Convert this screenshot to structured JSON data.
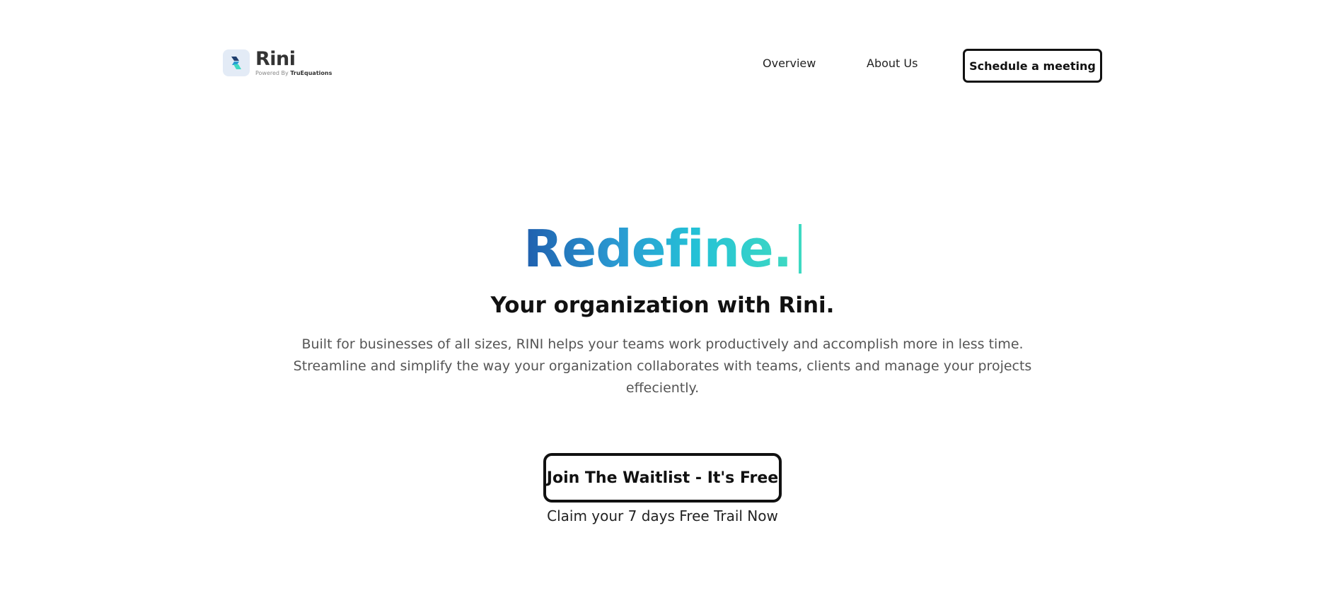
{
  "header": {
    "logo": {
      "name": "Rini",
      "tag_prefix": "Powered By",
      "tag_brand": "TruEquations",
      "icon": "rini-logo-icon"
    },
    "nav": [
      {
        "label": "Overview"
      },
      {
        "label": "About Us"
      }
    ],
    "schedule_label": "Schedule a meeting"
  },
  "hero": {
    "title": "Redefine.",
    "subtitle": "Your organization with Rini.",
    "description": "Built for businesses of all sizes, RINI helps your teams work productively and accomplish more in less time. Streamline and simplify the way your organization collaborates with teams, clients and manage your projects effeciently.",
    "cta_label": "Join The Waitlist - It's Free",
    "cta_sub": "Claim your 7 days Free Trail Now"
  },
  "colors": {
    "gradient_start": "#1f5fae",
    "gradient_end": "#3ed9c2",
    "text_dark": "#111111",
    "text_muted": "#555555",
    "logo_bg": "#e3ebf6"
  }
}
